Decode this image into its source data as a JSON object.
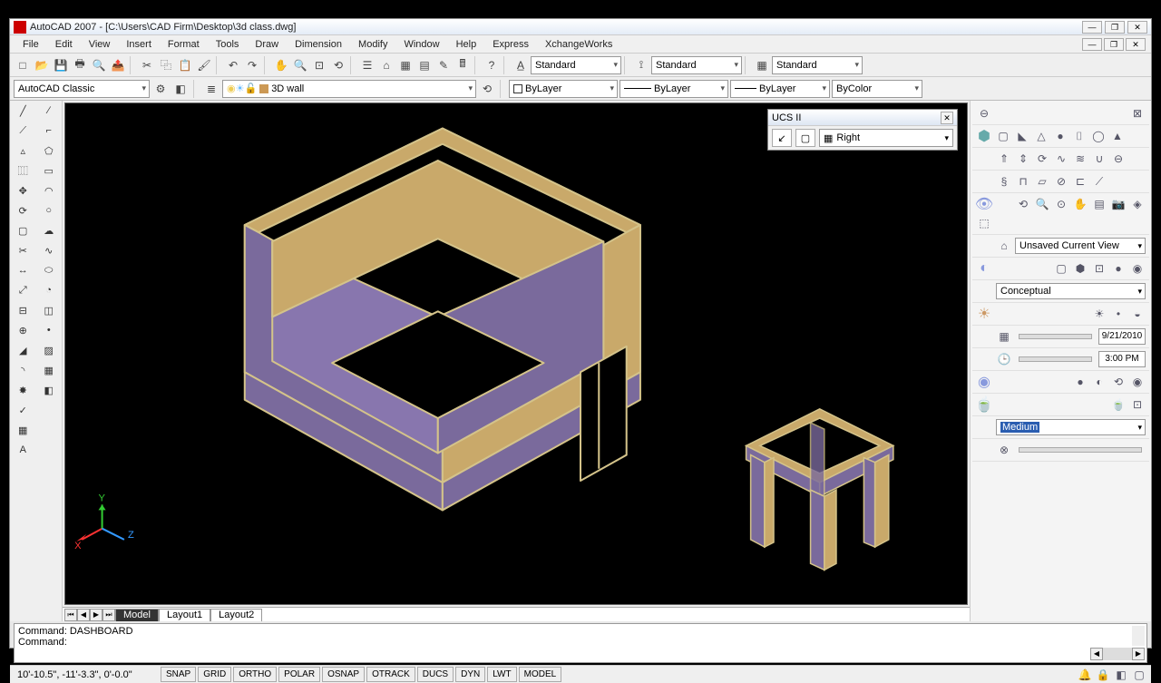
{
  "title": "AutoCAD 2007 - [C:\\Users\\CAD Firm\\Desktop\\3d class.dwg]",
  "menu": [
    "File",
    "Edit",
    "View",
    "Insert",
    "Format",
    "Tools",
    "Draw",
    "Dimension",
    "Modify",
    "Window",
    "Help",
    "Express",
    "XchangeWorks"
  ],
  "toolbar1": {
    "style1": "Standard",
    "style2": "Standard",
    "style3": "Standard"
  },
  "toolbar2": {
    "workspace": "AutoCAD Classic",
    "layer": "3D wall",
    "color": "ByLayer",
    "linetype": "ByLayer",
    "lineweight": "ByLayer",
    "plotstyle": "ByColor"
  },
  "ucs": {
    "title": "UCS II",
    "value": "Right"
  },
  "tabs": {
    "items": [
      "Model",
      "Layout1",
      "Layout2"
    ],
    "active": 0
  },
  "right": {
    "view": "Unsaved Current View",
    "visualstyle": "Conceptual",
    "date": "9/21/2010",
    "time": "3:00 PM",
    "quality": "Medium"
  },
  "cmd": {
    "line1": "Command: DASHBOARD",
    "line2": "Command:"
  },
  "status": {
    "coords": "10'-10.5\",  -11'-3.3\",  0'-0.0\"",
    "toggles": [
      "SNAP",
      "GRID",
      "ORTHO",
      "POLAR",
      "OSNAP",
      "OTRACK",
      "DUCS",
      "DYN",
      "LWT",
      "MODEL"
    ]
  },
  "axis": {
    "x": "X",
    "y": "Y",
    "z": "Z"
  }
}
